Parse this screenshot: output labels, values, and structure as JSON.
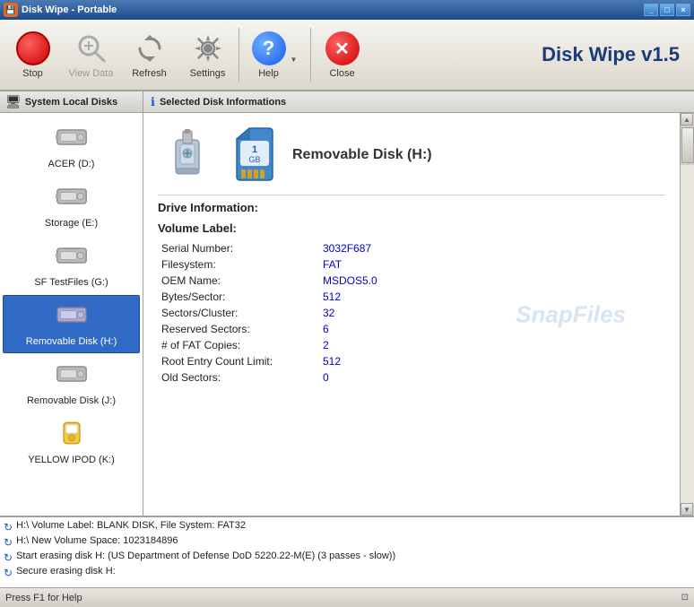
{
  "window": {
    "title": "Disk Wipe - Portable",
    "app_title": "Disk Wipe v1.5"
  },
  "toolbar": {
    "stop_label": "Stop",
    "viewdata_label": "View Data",
    "refresh_label": "Refresh",
    "settings_label": "Settings",
    "help_label": "Help",
    "close_label": "Close"
  },
  "sidebar": {
    "header": "System Local Disks",
    "disks": [
      {
        "id": "acer-d",
        "label": "ACER (D:)",
        "selected": false
      },
      {
        "id": "storage-e",
        "label": "Storage (E:)",
        "selected": false
      },
      {
        "id": "sf-testfiles-g",
        "label": "SF TestFiles (G:)",
        "selected": false
      },
      {
        "id": "removable-h",
        "label": "Removable Disk (H:)",
        "selected": true
      },
      {
        "id": "removable-j",
        "label": "Removable Disk (J:)",
        "selected": false
      },
      {
        "id": "yellow-ipod-k",
        "label": "YELLOW IPOD (K:)",
        "selected": false
      }
    ]
  },
  "panel": {
    "header": "Selected Disk Informations",
    "disk_name": "Removable Disk  (H:)",
    "drive_information_title": "Drive Information:",
    "volume_label_title": "Volume Label:",
    "fields": [
      {
        "label": "Serial Number:",
        "value": "3032F687"
      },
      {
        "label": "Filesystem:",
        "value": "FAT"
      },
      {
        "label": "OEM Name:",
        "value": "MSDOS5.0"
      },
      {
        "label": "Bytes/Sector:",
        "value": "512"
      },
      {
        "label": "Sectors/Cluster:",
        "value": "32"
      },
      {
        "label": "Reserved Sectors:",
        "value": "6"
      },
      {
        "label": "# of FAT Copies:",
        "value": "2"
      },
      {
        "label": "Root Entry Count Limit:",
        "value": "512"
      },
      {
        "label": "Old Sectors:",
        "value": "0"
      }
    ],
    "watermark": "SnapFiles"
  },
  "log": {
    "entries": [
      "H:\\ Volume Label: BLANK DISK, File System: FAT32",
      "H:\\ New Volume Space: 1023184896",
      "Start erasing disk H: (US Department of Defense DoD 5220.22-M(E) (3 passes - slow))",
      "Secure erasing disk H:"
    ]
  },
  "statusbar": {
    "text": "Press F1 for Help"
  }
}
